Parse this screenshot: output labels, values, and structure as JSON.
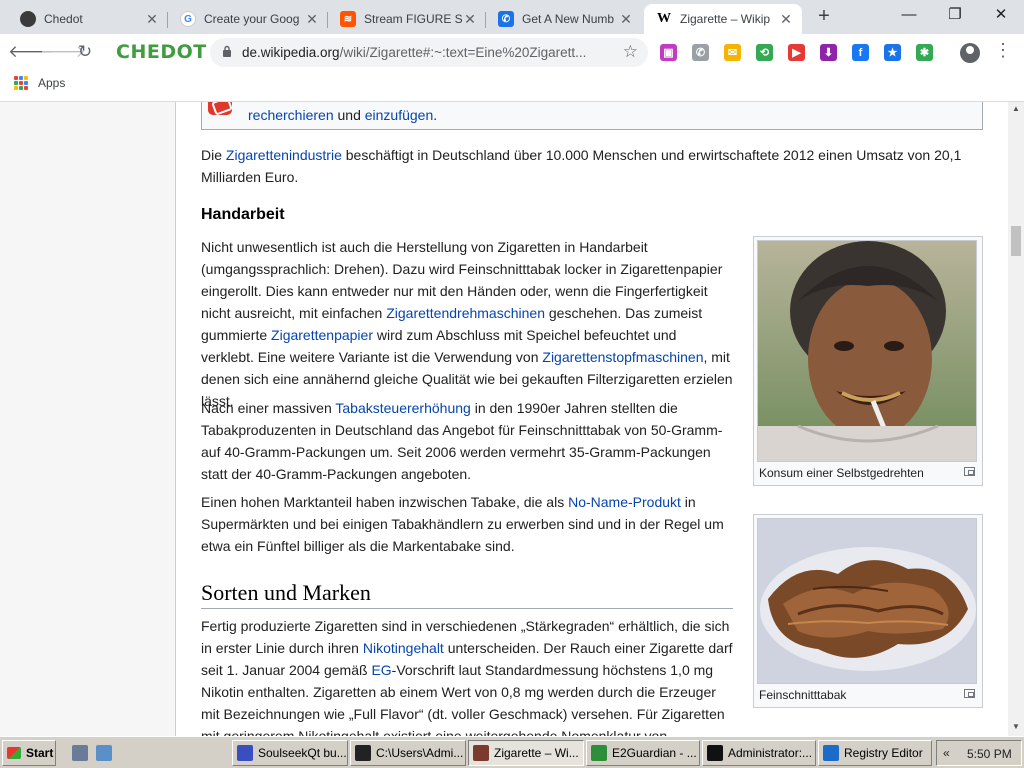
{
  "tabs": [
    {
      "title": "Chedot",
      "favicon": "chedot-icon",
      "color": "#3b3b3b",
      "glyph": "●"
    },
    {
      "title": "Create your Goog",
      "favicon": "google-icon",
      "color": "#4285f4",
      "glyph": "G"
    },
    {
      "title": "Stream FIGURE St",
      "favicon": "soundcloud-icon",
      "color": "#ff5500",
      "glyph": "≋"
    },
    {
      "title": "Get A New Numb",
      "favicon": "phone-icon",
      "color": "#1a73e8",
      "glyph": "✆"
    },
    {
      "title": "Zigarette – Wikip",
      "favicon": "wikipedia-icon",
      "color": "#ffffff",
      "glyph": "W"
    }
  ],
  "active_tab_index": 4,
  "window_controls": {
    "minimize": "—",
    "restore": "❐",
    "close": "✕"
  },
  "toolbar": {
    "brand": "CHEDOT",
    "url_host": "de.wikipedia.org",
    "url_rest": "/wiki/Zigarette#:~:text=Eine%20Zigarett..."
  },
  "extensions": [
    {
      "name": "video-ext-icon",
      "color": "#c33bc2",
      "glyph": "▣"
    },
    {
      "name": "whatsapp-icon",
      "color": "#9aa0a6",
      "glyph": "✆"
    },
    {
      "name": "messenger-icon",
      "color": "#f5b400",
      "glyph": "✉"
    },
    {
      "name": "share-ext-icon",
      "color": "#34a853",
      "glyph": "⟲"
    },
    {
      "name": "youtube-ext-icon",
      "color": "#e53935",
      "glyph": "▶"
    },
    {
      "name": "download-icon",
      "color": "#8e24aa",
      "glyph": "⬇"
    },
    {
      "name": "facebook-icon",
      "color": "#1877f2",
      "glyph": "f"
    },
    {
      "name": "bookmark-star-icon",
      "color": "#1a73e8",
      "glyph": "★"
    },
    {
      "name": "settings-ext-icon",
      "color": "#34a853",
      "glyph": "✱"
    }
  ],
  "bookmarks": {
    "apps_label": "Apps"
  },
  "article": {
    "notice_link1": "recherchieren",
    "notice_mid": " und ",
    "notice_link2": "einzufügen",
    "notice_end": ".",
    "p1_a": "Die ",
    "p1_link": "Zigarettenindustrie",
    "p1_b": " beschäftigt in Deutschland über 10.000 Menschen und erwirtschaftete 2012 einen Umsatz von 20,1 Milliarden Euro.",
    "h_handarbeit": "Handarbeit",
    "p2_a": "Nicht unwesentlich ist auch die Herstellung von Zigaretten in Handarbeit (umgangssprachlich: Drehen). Dazu wird Feinschnitttabak locker in Zigarettenpapier eingerollt. Dies kann entweder nur mit den Händen oder, wenn die Fingerfertigkeit nicht ausreicht, mit einfachen ",
    "p2_link1": "Zigarettendrehmaschinen",
    "p2_b": " geschehen. Das zumeist gummierte ",
    "p2_link2": "Zigarettenpapier",
    "p2_c": " wird zum Abschluss mit Speichel befeuchtet und verklebt. Eine weitere Variante ist die Verwendung von ",
    "p2_link3": "Zigarettenstopfmaschinen",
    "p2_d": ", mit denen sich eine annähernd gleiche Qualität wie bei gekauften Filterzigaretten erzielen lässt.",
    "p3_a": "Nach einer massiven ",
    "p3_link": "Tabaksteuererhöhung",
    "p3_b": " in den 1990er Jahren stellten die Tabakproduzenten in Deutschland das Angebot für Feinschnitttabak von 50-Gramm- auf 40-Gramm-Packungen um. Seit 2006 werden vermehrt 35-Gramm-Packungen statt der 40-Gramm-Packungen angeboten.",
    "p4_a": "Einen hohen Marktanteil haben inzwischen Tabake, die als ",
    "p4_link": "No-Name-Produkt",
    "p4_b": " in Supermärkten und bei einigen Tabakhändlern zu erwerben sind und in der Regel um etwa ein Fünftel billiger als die Markentabake sind.",
    "h_sorten": "Sorten und Marken",
    "p5_a": "Fertig produzierte Zigaretten sind in verschiedenen „Stärkegraden“ erhältlich, die sich in erster Linie durch ihren ",
    "p5_link1": "Nikotingehalt",
    "p5_b": " unterscheiden. Der Rauch einer Zigarette darf seit 1. Januar 2004 gemäß ",
    "p5_link2": "EG",
    "p5_c": "-Vorschrift laut Standardmessung höchstens 1,0 mg Nikotin enthalten. Zigaretten ab einem Wert von 0,8 mg werden durch die Erzeuger mit Bezeichnungen wie „Full Flavor“ (dt. voller Geschmack) versehen. Für Zigaretten mit geringerem Nikotingehalt existiert eine weitergehende Nomenklatur von",
    "caption1": "Konsum einer Selbstgedrehten",
    "caption2": "Feinschnitttabak"
  },
  "taskbar": {
    "start": "Start",
    "items": [
      {
        "label": "SoulseekQt bu...",
        "icon": "soulseek-icon",
        "color": "#3a4fbf"
      },
      {
        "label": "C:\\Users\\Admi...",
        "icon": "7zip-icon",
        "color": "#222222"
      },
      {
        "label": "Zigarette – Wi...",
        "icon": "chedot-icon",
        "color": "#7a3b2e"
      },
      {
        "label": "E2Guardian - ...",
        "icon": "e2guardian-icon",
        "color": "#2d8f3a"
      },
      {
        "label": "Administrator:...",
        "icon": "cmd-icon",
        "color": "#111111"
      },
      {
        "label": "Registry Editor",
        "icon": "regedit-icon",
        "color": "#1c6cc7"
      }
    ],
    "clock": "5:50 PM",
    "tray_arrow": "«"
  }
}
